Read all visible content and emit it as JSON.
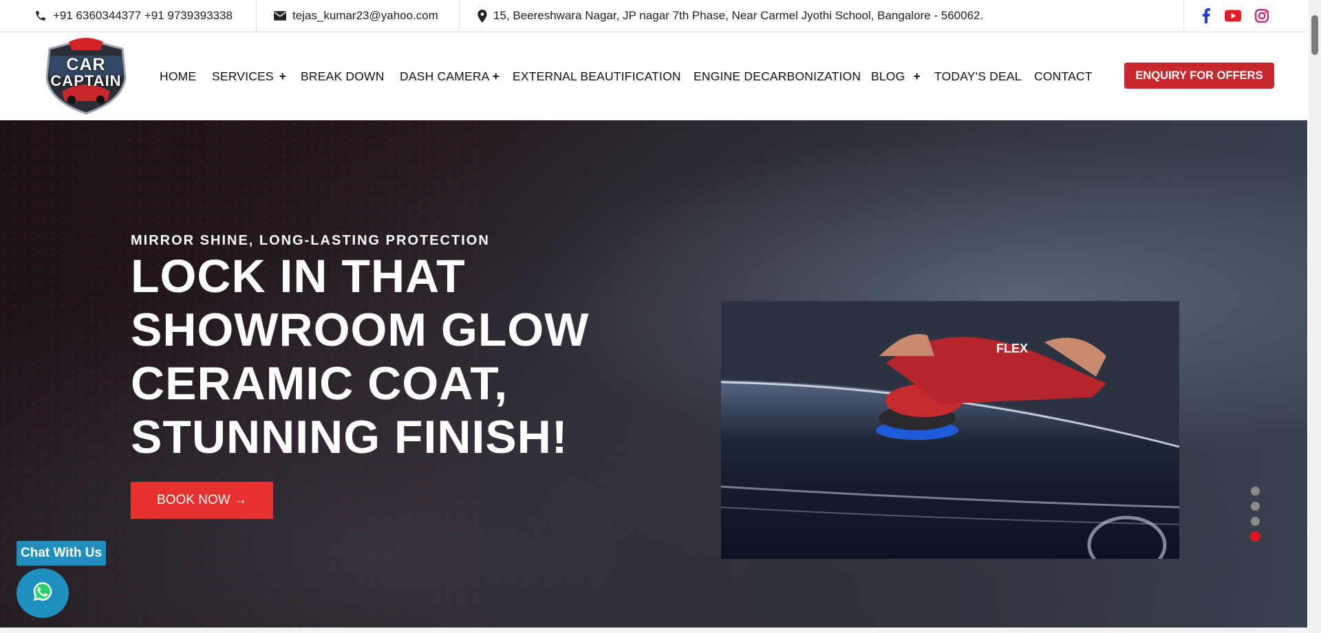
{
  "topbar": {
    "phone": "+91 6360344377 +91 9739393338",
    "email": "tejas_kumar23@yahoo.com",
    "address": "15, Beereshwara Nagar, JP nagar 7th Phase, Near Carmel Jyothi School, Bangalore - 560062.",
    "social": [
      "facebook-icon",
      "youtube-icon",
      "instagram-icon"
    ]
  },
  "logo": {
    "line1": "CAR",
    "line2": "CAPTAIN"
  },
  "nav": {
    "items": [
      {
        "label": "HOME"
      },
      {
        "label": "SERVICES",
        "plus": "+"
      },
      {
        "label": "BREAK DOWN"
      },
      {
        "label": "DASH CAMERA",
        "plus": "+"
      },
      {
        "label": "EXTERNAL BEAUTIFICATION"
      },
      {
        "label": "ENGINE DECARBONIZATION"
      },
      {
        "label": "BLOG",
        "plus": "+"
      },
      {
        "label": "TODAY'S DEAL"
      },
      {
        "label": "CONTACT"
      }
    ],
    "cta": "ENQUIRY FOR OFFERS"
  },
  "hero": {
    "subtitle": "MIRROR SHINE, LONG-LASTING PROTECTION",
    "headline": [
      "LOCK IN THAT",
      "SHOWROOM GLOW",
      "CERAMIC COAT,",
      "STUNNING FINISH!"
    ],
    "button": "BOOK NOW →",
    "image_brand": "FLEX",
    "slides": 4,
    "active_slide": 4
  },
  "chat": {
    "label": "Chat With Us"
  },
  "colors": {
    "accent": "#c8272d",
    "button": "#e8312f",
    "chat": "#1f8fc0",
    "facebook": "#1b3bd6",
    "youtube": "#e31b23",
    "instagram": "#d6145f"
  }
}
